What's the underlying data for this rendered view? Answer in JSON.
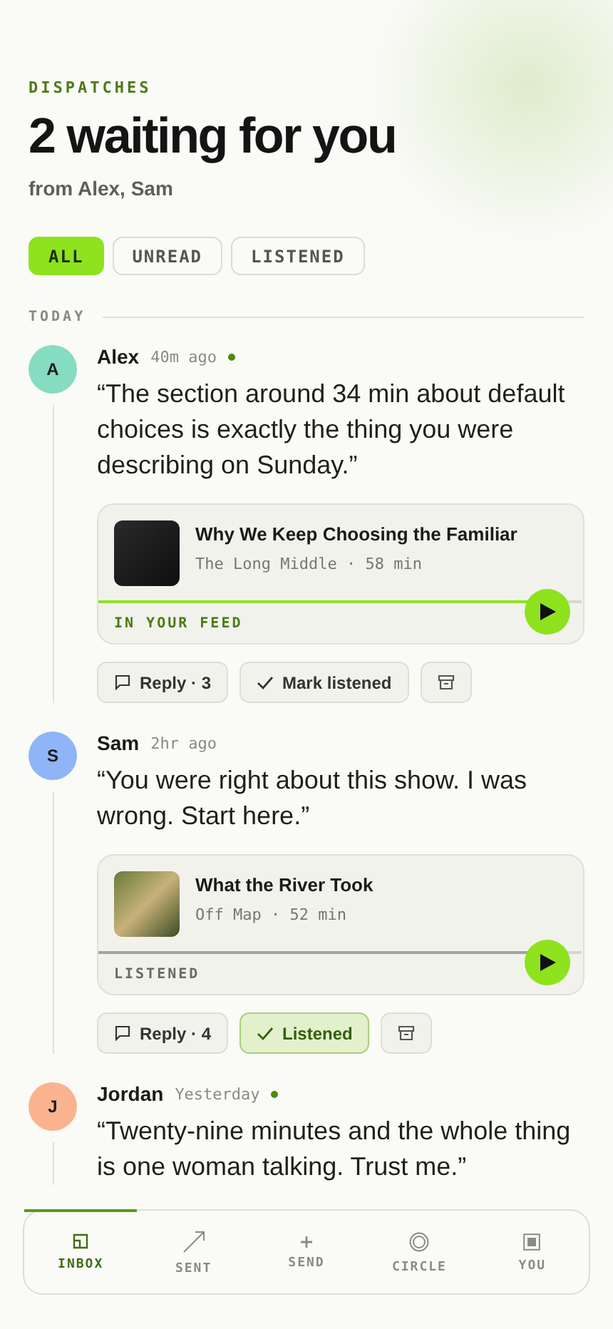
{
  "header": {
    "eyebrow": "DISPATCHES",
    "title": "2 waiting for you",
    "subtitle": "from Alex, Sam"
  },
  "filters": [
    {
      "label": "ALL",
      "selected": true
    },
    {
      "label": "UNREAD",
      "selected": false
    },
    {
      "label": "LISTENED",
      "selected": false
    }
  ],
  "section": "TODAY",
  "dispatches": [
    {
      "initial": "A",
      "color": "#86dcc0",
      "name": "Alex",
      "time": "40m ago",
      "unread": true,
      "quote": "“The section around 34 min about default choices is exactly the thing you were describing on Sunday.”",
      "episode": {
        "title": "Why We Keep Choosing the Familiar",
        "meta": "The Long Middle · 58 min",
        "status": "IN YOUR FEED",
        "listened": false,
        "level": 0.95
      },
      "reply": "Reply · 3",
      "mark": {
        "label": "Mark listened",
        "selected": false
      }
    },
    {
      "initial": "S",
      "color": "#8fb4f7",
      "name": "Sam",
      "time": "2hr ago",
      "unread": false,
      "quote": "“You were right about this show. I was wrong. Start here.”",
      "episode": {
        "title": "What the River Took",
        "meta": "Off Map · 52 min",
        "status": "LISTENED",
        "listened": true,
        "level": 0.95
      },
      "reply": "Reply · 4",
      "mark": {
        "label": "Listened",
        "selected": true
      }
    },
    {
      "initial": "J",
      "color": "#f9b48f",
      "name": "Jordan",
      "time": "Yesterday",
      "unread": true,
      "quote": "“Twenty-nine minutes and the whole thing is one woman talking. Trust me.”"
    }
  ],
  "nav": [
    {
      "label": "INBOX",
      "selected": true
    },
    {
      "label": "SENT",
      "selected": false
    },
    {
      "label": "SEND",
      "selected": false
    },
    {
      "label": "CIRCLE",
      "selected": false
    },
    {
      "label": "YOU",
      "selected": false
    }
  ]
}
